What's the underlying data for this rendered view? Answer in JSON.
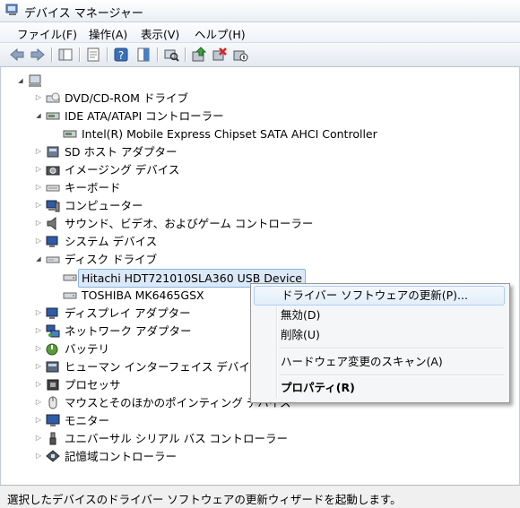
{
  "window": {
    "title": "デバイス マネージャー"
  },
  "menu": [
    "ファイル(F)",
    "操作(A)",
    "表示(V)",
    "ヘルプ(H)"
  ],
  "tree": {
    "root": "",
    "items": [
      {
        "label": "DVD/CD-ROM ドライブ",
        "state": "collapsed",
        "icon": "dvd-drive-icon"
      },
      {
        "label": "IDE ATA/ATAPI コントローラー",
        "state": "expanded",
        "icon": "ide-controller-icon"
      },
      {
        "label": "Intel(R) Mobile Express Chipset SATA AHCI Controller",
        "state": "leaf",
        "icon": "controller-device-icon"
      },
      {
        "label": "SD ホスト アダプター",
        "state": "collapsed",
        "icon": "sd-host-icon"
      },
      {
        "label": "イメージング デバイス",
        "state": "collapsed",
        "icon": "camera-icon"
      },
      {
        "label": "キーボード",
        "state": "collapsed",
        "icon": "keyboard-icon"
      },
      {
        "label": "コンピューター",
        "state": "collapsed",
        "icon": "computer-icon"
      },
      {
        "label": "サウンド、ビデオ、およびゲーム コントローラー",
        "state": "collapsed",
        "icon": "speaker-icon"
      },
      {
        "label": "システム デバイス",
        "state": "collapsed",
        "icon": "system-device-icon"
      },
      {
        "label": "ディスク ドライブ",
        "state": "expanded",
        "icon": "disk-drive-icon"
      },
      {
        "label": "Hitachi HDT721010SLA360 USB Device",
        "state": "leaf",
        "icon": "hard-disk-icon",
        "selected": true
      },
      {
        "label": "TOSHIBA MK6465GSX",
        "state": "leaf",
        "icon": "hard-disk-icon"
      },
      {
        "label": "ディスプレイ アダプター",
        "state": "collapsed",
        "icon": "display-adapter-icon"
      },
      {
        "label": "ネットワーク アダプター",
        "state": "collapsed",
        "icon": "network-adapter-icon"
      },
      {
        "label": "バッテリ",
        "state": "collapsed",
        "icon": "battery-icon"
      },
      {
        "label": "ヒューマン インターフェイス デバイス",
        "state": "collapsed",
        "icon": "hid-icon"
      },
      {
        "label": "プロセッサ",
        "state": "collapsed",
        "icon": "processor-icon"
      },
      {
        "label": "マウスとそのほかのポインティング デバイス",
        "state": "collapsed",
        "icon": "mouse-icon"
      },
      {
        "label": "モニター",
        "state": "collapsed",
        "icon": "monitor-icon"
      },
      {
        "label": "ユニバーサル シリアル バス コントローラー",
        "state": "collapsed",
        "icon": "usb-icon"
      },
      {
        "label": "記憶域コントローラー",
        "state": "collapsed",
        "icon": "storage-controller-icon"
      }
    ]
  },
  "context_menu": {
    "items": [
      {
        "label": "ドライバー ソフトウェアの更新(P)...",
        "highlighted": true
      },
      {
        "label": "無効(D)"
      },
      {
        "label": "削除(U)"
      },
      {
        "label": "ハードウェア変更のスキャン(A)"
      },
      {
        "label": "プロパティ(R)",
        "bold": true
      }
    ]
  },
  "status": {
    "text": "選択したデバイスのドライバー ソフトウェアの更新ウィザードを起動します。"
  },
  "colors": {
    "accent": "#3a7bd5",
    "selection": "#dbe8f7",
    "menu_highlight": "#e2eefa"
  }
}
